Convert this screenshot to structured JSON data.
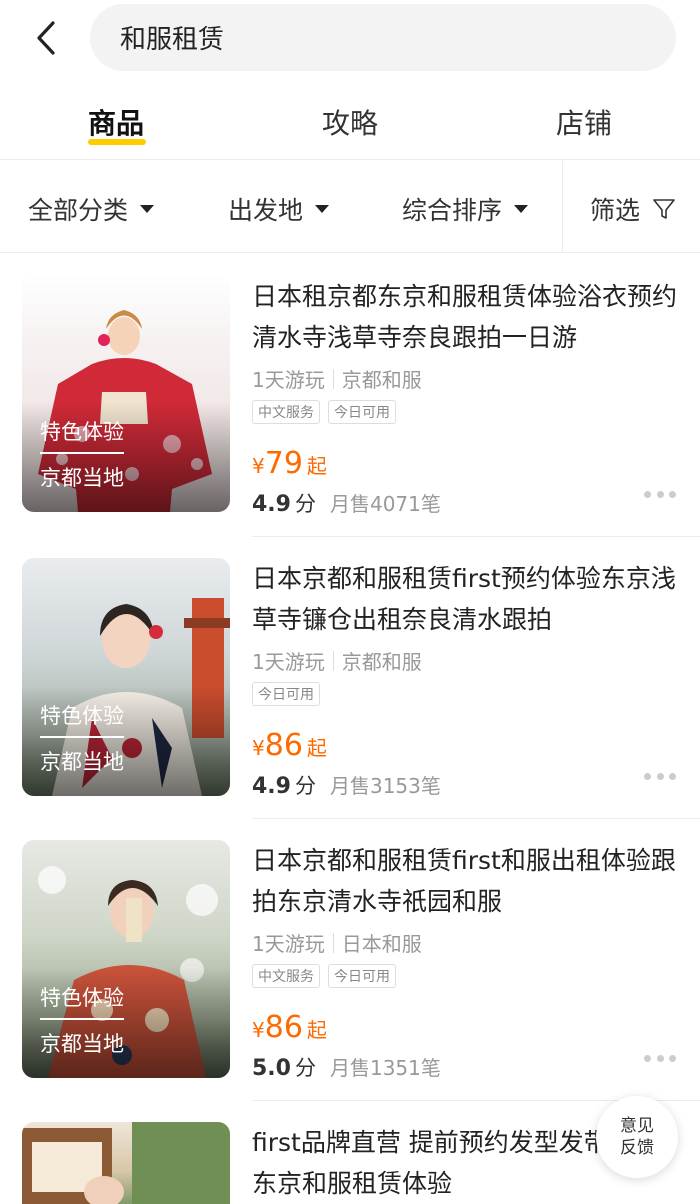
{
  "search": {
    "query": "和服租赁"
  },
  "tabs": [
    {
      "label": "商品",
      "active": true
    },
    {
      "label": "攻略",
      "active": false
    },
    {
      "label": "店铺",
      "active": false
    }
  ],
  "filters": {
    "category": "全部分类",
    "departure": "出发地",
    "sort": "综合排序",
    "filter": "筛选"
  },
  "products": [
    {
      "title": "日本租京都东京和服租赁体验浴衣预约清水寺浅草寺奈良跟拍一日游",
      "badge1": "特色体验",
      "badge2": "京都当地",
      "meta1": "1天游玩",
      "meta2": "京都和服",
      "tags": [
        "中文服务",
        "今日可用"
      ],
      "currency": "¥",
      "price": "79",
      "price_suffix": "起",
      "score": "4.9",
      "score_unit": "分",
      "sold": "月售4071笔"
    },
    {
      "title": "日本京都和服租赁first预约体验东京浅草寺镰仓出租奈良清水跟拍",
      "badge1": "特色体验",
      "badge2": "京都当地",
      "meta1": "1天游玩",
      "meta2": "京都和服",
      "tags": [
        "今日可用"
      ],
      "currency": "¥",
      "price": "86",
      "price_suffix": "起",
      "score": "4.9",
      "score_unit": "分",
      "sold": "月售3153笔"
    },
    {
      "title": "日本京都和服租赁first和服出租体验跟拍东京清水寺祇园和服",
      "badge1": "特色体验",
      "badge2": "京都当地",
      "meta1": "1天游玩",
      "meta2": "日本和服",
      "tags": [
        "中文服务",
        "今日可用"
      ],
      "currency": "¥",
      "price": "86",
      "price_suffix": "起",
      "score": "5.0",
      "score_unit": "分",
      "sold": "月售1351笔"
    },
    {
      "title": "first品牌直营 提前预约发型发带 京都东京和服租赁体验"
    }
  ],
  "feedback": {
    "line1": "意见",
    "line2": "反馈"
  }
}
